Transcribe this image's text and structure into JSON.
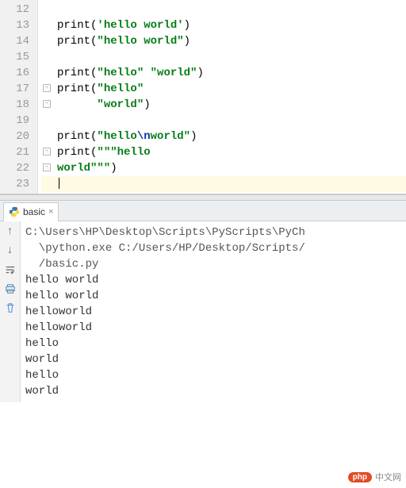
{
  "editor": {
    "lines": [
      {
        "num": "12",
        "tokens": []
      },
      {
        "num": "13",
        "tokens": [
          {
            "t": "fn",
            "v": "print"
          },
          {
            "t": "paren",
            "v": "("
          },
          {
            "t": "str",
            "v": "'hello world'"
          },
          {
            "t": "paren",
            "v": ")"
          }
        ]
      },
      {
        "num": "14",
        "tokens": [
          {
            "t": "fn",
            "v": "print"
          },
          {
            "t": "paren",
            "v": "("
          },
          {
            "t": "str",
            "v": "\"hello world\""
          },
          {
            "t": "paren",
            "v": ")"
          }
        ]
      },
      {
        "num": "15",
        "tokens": []
      },
      {
        "num": "16",
        "tokens": [
          {
            "t": "fn",
            "v": "print"
          },
          {
            "t": "paren",
            "v": "("
          },
          {
            "t": "str",
            "v": "\"hello\""
          },
          {
            "t": "plain",
            "v": " "
          },
          {
            "t": "str",
            "v": "\"world\""
          },
          {
            "t": "paren",
            "v": ")"
          }
        ]
      },
      {
        "num": "17",
        "fold": true,
        "tokens": [
          {
            "t": "fn",
            "v": "print"
          },
          {
            "t": "paren",
            "v": "("
          },
          {
            "t": "str",
            "v": "\"hello\""
          }
        ]
      },
      {
        "num": "18",
        "fold": true,
        "indent": "      ",
        "tokens": [
          {
            "t": "str",
            "v": "\"world\""
          },
          {
            "t": "paren",
            "v": ")"
          }
        ]
      },
      {
        "num": "19",
        "tokens": []
      },
      {
        "num": "20",
        "tokens": [
          {
            "t": "fn",
            "v": "print"
          },
          {
            "t": "paren",
            "v": "("
          },
          {
            "t": "str",
            "v": "\"hello"
          },
          {
            "t": "esc",
            "v": "\\n"
          },
          {
            "t": "str",
            "v": "world\""
          },
          {
            "t": "paren",
            "v": ")"
          }
        ]
      },
      {
        "num": "21",
        "fold": true,
        "tokens": [
          {
            "t": "fn",
            "v": "print"
          },
          {
            "t": "paren",
            "v": "("
          },
          {
            "t": "str",
            "v": "\"\"\"hello"
          }
        ]
      },
      {
        "num": "22",
        "fold": true,
        "noindent": true,
        "tokens": [
          {
            "t": "str",
            "v": "world\"\"\""
          },
          {
            "t": "paren",
            "v": ")"
          }
        ]
      },
      {
        "num": "23",
        "current": true,
        "tokens": []
      }
    ]
  },
  "tab": {
    "label": "basic",
    "close": "×"
  },
  "toolbar": {
    "up": "↑",
    "down": "↓"
  },
  "console": {
    "cmd1": "C:\\Users\\HP\\Desktop\\Scripts\\PyScripts\\PyCh",
    "cmd2": "  \\python.exe C:/Users/HP/Desktop/Scripts/",
    "cmd3": "  /basic.py",
    "out": [
      "hello world",
      "hello world",
      "helloworld",
      "helloworld",
      "hello",
      "world",
      "hello",
      "world"
    ]
  },
  "watermark": {
    "badge": "php",
    "text": "中文网"
  }
}
